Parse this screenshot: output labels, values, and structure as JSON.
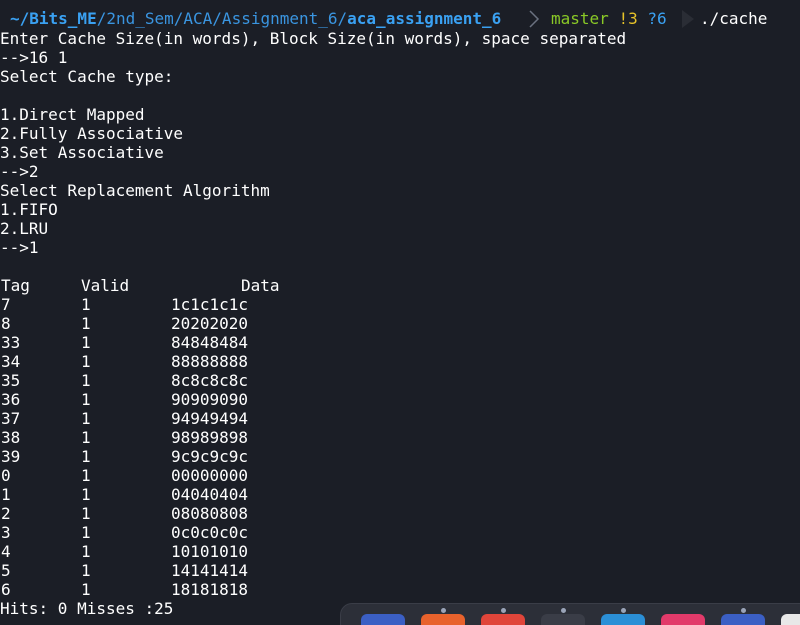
{
  "prompt": {
    "path_home": "~/Bits_ME",
    "path_mid": "/2nd_Sem/ACA/Assignment_6/",
    "path_last": "aca_assignment_6",
    "git_branch": "master",
    "git_modified": "!3",
    "git_untracked": "?6",
    "command": "./cache"
  },
  "output_lines": [
    "Enter Cache Size(in words), Block Size(in words), space separated",
    "-->16 1",
    "Select Cache type:",
    "",
    "1.Direct Mapped",
    "2.Fully Associative",
    "3.Set Associative",
    "-->2",
    "Select Replacement Algorithm",
    "1.FIFO",
    "2.LRU",
    "-->1",
    ""
  ],
  "table": {
    "headers": [
      "Tag",
      "Valid",
      "Data"
    ],
    "rows": [
      [
        "7",
        "1",
        "1c1c1c1c"
      ],
      [
        "8",
        "1",
        "20202020"
      ],
      [
        "33",
        "1",
        "84848484"
      ],
      [
        "34",
        "1",
        "88888888"
      ],
      [
        "35",
        "1",
        "8c8c8c8c"
      ],
      [
        "36",
        "1",
        "90909090"
      ],
      [
        "37",
        "1",
        "94949494"
      ],
      [
        "38",
        "1",
        "98989898"
      ],
      [
        "39",
        "1",
        "9c9c9c9c"
      ],
      [
        "0",
        "1",
        "00000000"
      ],
      [
        "1",
        "1",
        "04040404"
      ],
      [
        "2",
        "1",
        "08080808"
      ],
      [
        "3",
        "1",
        "0c0c0c0c"
      ],
      [
        "4",
        "1",
        "10101010"
      ],
      [
        "5",
        "1",
        "14141414"
      ],
      [
        "6",
        "1",
        "18181818"
      ]
    ]
  },
  "summary": "Hits: 0 Misses :25",
  "dock": {
    "icons": [
      {
        "name": "kate-icon",
        "color": "#3b5fc4",
        "dot": false
      },
      {
        "name": "firefox-icon",
        "color": "#e8622c",
        "dot": true
      },
      {
        "name": "record-icon",
        "color": "#e0453a",
        "dot": true
      },
      {
        "name": "terminal-icon",
        "color": "#3a3d47",
        "dot": true
      },
      {
        "name": "vscode-icon",
        "color": "#2b8fd6",
        "dot": true
      },
      {
        "name": "app-icon",
        "color": "#e23a6a",
        "dot": false
      },
      {
        "name": "window-icon",
        "color": "#3b5fc4",
        "dot": true
      },
      {
        "name": "chrome-icon",
        "color": "#e8e8e8",
        "dot": false
      }
    ]
  }
}
